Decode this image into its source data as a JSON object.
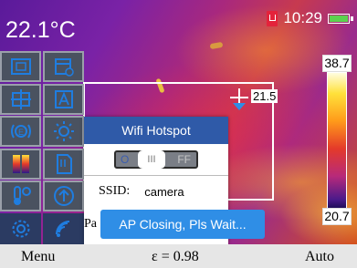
{
  "status": {
    "center_temperature": "22.1°C",
    "clock": "10:29",
    "battery_icon": "battery-icon",
    "sd_icon": "sd-card-icon"
  },
  "scale": {
    "max": "38.7",
    "min": "20.7"
  },
  "cursor": {
    "temperature": "21.5"
  },
  "menu": {
    "tiles": [
      {
        "icon": "measure-area-icon",
        "selected": false
      },
      {
        "icon": "calendar-settings-icon",
        "selected": false
      },
      {
        "icon": "center-spot-icon",
        "selected": false
      },
      {
        "icon": "picture-a-icon",
        "selected": false
      },
      {
        "icon": "emissivity-icon",
        "selected": false
      },
      {
        "icon": "brightness-icon",
        "selected": false
      },
      {
        "icon": "color-palette-icon",
        "selected": false
      },
      {
        "icon": "document-icon",
        "selected": false
      },
      {
        "icon": "temperature-settings-icon",
        "selected": false
      },
      {
        "icon": "arrow-up-icon",
        "selected": false
      },
      {
        "icon": "gear-icon",
        "selected": true
      },
      {
        "icon": "wifi-icon",
        "selected": false
      }
    ]
  },
  "popup": {
    "title": "Wifi Hotspot",
    "toggle": {
      "on_label": "O",
      "off_label": "FF",
      "knob_label": "III",
      "state": "off"
    },
    "ssid_label": "SSID:",
    "ssid_value": "camera",
    "password_label": "Pa"
  },
  "toast": "AP Closing, Pls Wait...",
  "bottom": {
    "menu_label": "Menu",
    "emissivity": "ε = 0.98",
    "mode_label": "Auto"
  },
  "colors": {
    "selected_tile": "#2b3b62",
    "popup_header": "#2f5aa8",
    "toast_bg": "#2f8ee6",
    "tile_bg": "#4a5260"
  }
}
